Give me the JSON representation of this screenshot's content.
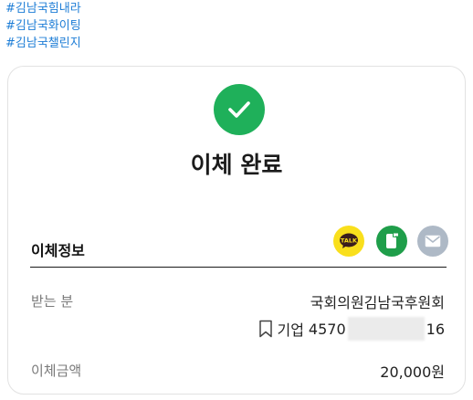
{
  "hashtags": [
    "#김남국힘내라",
    "#김남국화이팅",
    "#김남국챌린지"
  ],
  "receipt": {
    "title": "이체 완료",
    "section_title": "이체정보",
    "share_icons": [
      "kakaotalk-icon",
      "sms-icon",
      "mail-icon"
    ],
    "recipient_label": "받는 분",
    "recipient_name": "국회의원김남국후원회",
    "bank_name": "기업",
    "account_prefix": "4570",
    "account_suffix": "16",
    "amount_label": "이체금액",
    "amount": "20,000원"
  },
  "colors": {
    "hashtag": "#1d7dd6",
    "success": "#1fb05a",
    "kakao": "#f9df1c",
    "sms": "#1f9e4a",
    "mail": "#aeb9c6"
  }
}
